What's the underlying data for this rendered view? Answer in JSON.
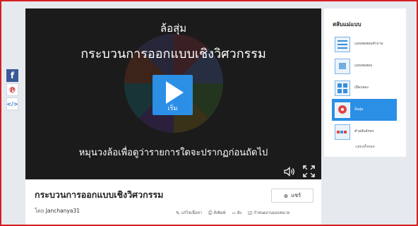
{
  "share_sidebar": {
    "icons": [
      "facebook-icon",
      "pinterest-icon",
      "embed-icon"
    ],
    "facebook_glyph": "f",
    "pinterest_glyph": "℗",
    "embed_glyph": "</>"
  },
  "stage": {
    "title": "ล้อสุ่ม",
    "activity_name": "กระบวนการออกแบบเชิงวิศวกรรม",
    "start_label": "เริ่ม",
    "instructions": "หมุนวงล้อเพื่อดูว่ารายการใดจะปรากฏก่อนถัดไป"
  },
  "info": {
    "title": "กระบวนการออกแบบเชิงวิศวกรรม",
    "share_label": "แชร์",
    "author_prefix": "โดย",
    "author_name": "Janchanya31",
    "actions": [
      {
        "icon": "pencil-icon",
        "glyph": "✎",
        "label": "แก้ไขเนื้อหา"
      },
      {
        "icon": "print-icon",
        "glyph": "⎙",
        "label": "สั่งพิมพ์"
      },
      {
        "icon": "embed-icon",
        "glyph": "‹›",
        "label": "ฝัง"
      },
      {
        "icon": "checkbox-icon",
        "glyph": "☑",
        "label": "กำหนดงานมอบหมาย"
      }
    ]
  },
  "templates": {
    "title": "สลับแม่แบบ",
    "items": [
      {
        "label": "แบบทดสอบคำถาม",
        "icon": "quiz-icon",
        "active": false
      },
      {
        "label": "แบบทดสอบ",
        "icon": "match-icon",
        "active": false
      },
      {
        "label": "เปิดกล่อง",
        "icon": "boxes-icon",
        "active": false
      },
      {
        "label": "ล้อสุ่ม",
        "icon": "wheel-icon",
        "active": true
      },
      {
        "label": "คำสลับอักษร",
        "icon": "anagram-icon",
        "active": false
      }
    ],
    "show_more": "แสดงทั้งหมด"
  },
  "colors": {
    "accent": "#2b8fe6",
    "frame": "#d42020",
    "stage_background": "#1b1b1b",
    "page_background": "#e6e9ee"
  }
}
